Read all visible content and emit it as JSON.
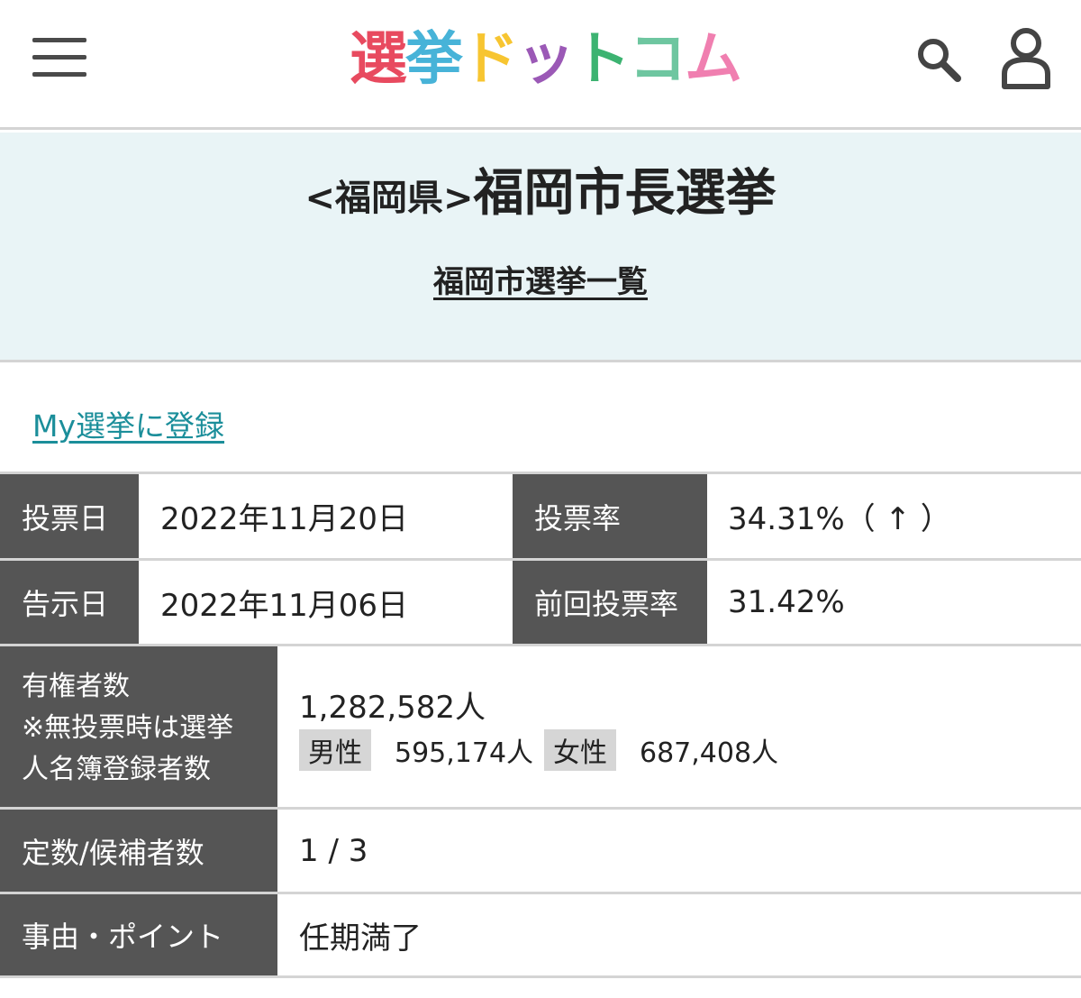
{
  "header": {
    "logo": {
      "chars": [
        {
          "text": "選",
          "color": "#e84a5f"
        },
        {
          "text": "挙",
          "color": "#47b3d8"
        },
        {
          "text": "ド",
          "color": "#f7c531"
        },
        {
          "text": "ッ",
          "color": "#9b59b6"
        },
        {
          "text": "ト",
          "color": "#3cb371"
        },
        {
          "text": "コ",
          "color": "#6ec6a0"
        },
        {
          "text": "ム",
          "color": "#f07fb0"
        }
      ]
    },
    "icons": [
      "menu-icon",
      "search-icon",
      "user-icon"
    ]
  },
  "title": {
    "prefecture": "<福岡県>",
    "election": "福岡市長選挙",
    "list_link": "福岡市選挙一覧"
  },
  "my_link": "My選挙に登録",
  "info": {
    "vote_date_label": "投票日",
    "vote_date": "2022年11月20日",
    "turnout_label": "投票率",
    "turnout": "34.31%（ ↑ ）",
    "notice_date_label": "告示日",
    "notice_date": "2022年11月06日",
    "prev_turnout_label": "前回投票率",
    "prev_turnout": "31.42%",
    "voters_label_1": "有権者数",
    "voters_label_2": "※無投票時は選挙",
    "voters_label_3": "人名簿登録者数",
    "voters_total": "1,282,582人",
    "male_label": "男性",
    "male_count": "595,174人",
    "female_label": "女性",
    "female_count": "687,408人",
    "seats_label": "定数/候補者数",
    "seats": "1 / 3",
    "reason_label": "事由・ポイント",
    "reason": "任期満了"
  },
  "colors": {
    "header_bg": "#ffffff",
    "title_band_bg": "#e9f4f6",
    "table_header_bg": "#555555",
    "link_color": "#1b8e9a",
    "gender_tag_bg": "#d6d6d6"
  }
}
